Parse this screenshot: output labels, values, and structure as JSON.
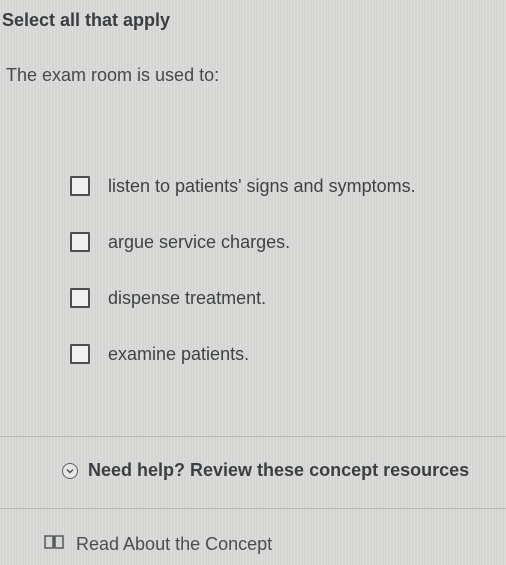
{
  "header": {
    "instruction": "Select all that apply"
  },
  "question": {
    "prompt": "The exam room is used to:"
  },
  "options": [
    {
      "label": "listen to patients' signs and symptoms.",
      "checked": false
    },
    {
      "label": "argue service charges.",
      "checked": false
    },
    {
      "label": "dispense treatment.",
      "checked": false
    },
    {
      "label": "examine patients.",
      "checked": false
    }
  ],
  "help": {
    "text": "Need help? Review these concept resources"
  },
  "resources": {
    "read_label": "Read About the Concept"
  },
  "colors": {
    "background": "#d9dad8",
    "text": "#3b3f43",
    "divider": "#b9bbb9"
  },
  "icons": {
    "help_toggle": "chevron-down-circle-icon",
    "read": "book-icon"
  }
}
